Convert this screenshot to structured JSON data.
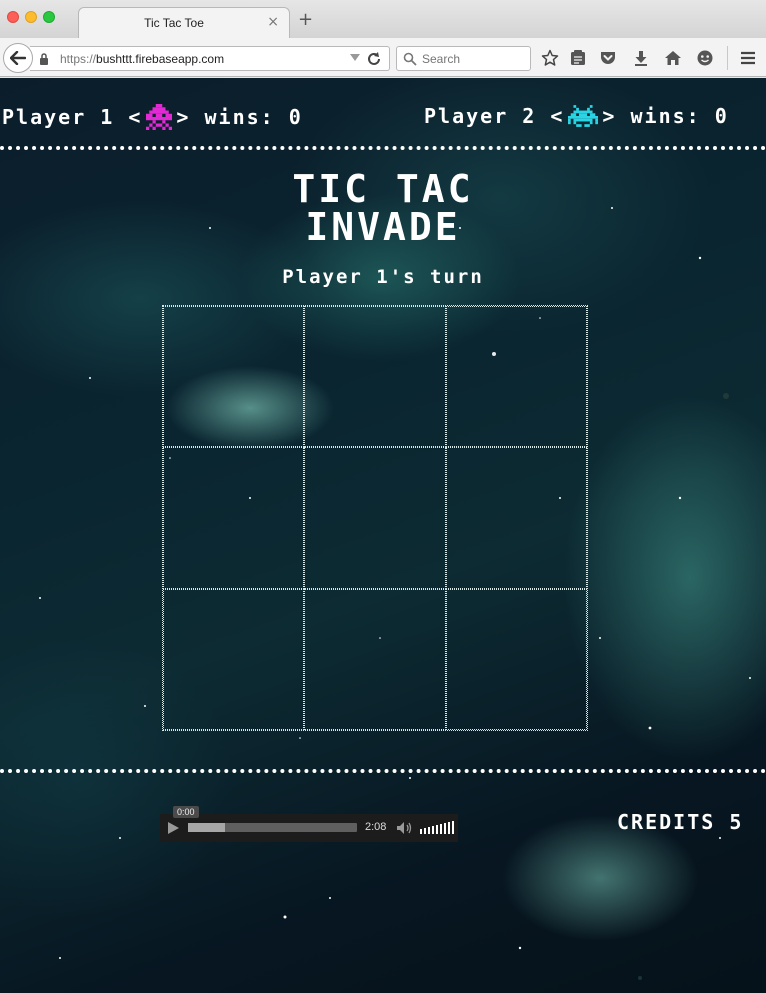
{
  "browser": {
    "tab_title": "Tic Tac Toe",
    "tab_close": "×",
    "new_tab": "+",
    "url_prefix": "https://",
    "url_host": "bushttt.firebaseapp.com",
    "search_placeholder": "Search",
    "toolbar_icons": [
      "star-icon",
      "reading-list-icon",
      "pocket-icon",
      "download-icon",
      "home-icon",
      "emoji-icon",
      "menu-icon"
    ]
  },
  "header": {
    "player1_label": "Player 1 <",
    "player1_suffix": "> wins: 0",
    "player1_icon": "squid-invader-icon",
    "player1_color": "#e22ad4",
    "player2_label": "Player 2 <",
    "player2_suffix": "> wins: 0",
    "player2_icon": "crab-invader-icon",
    "player2_color": "#2ad4e2"
  },
  "game": {
    "title_line1": "TIC TAC",
    "title_line2": "INVADE",
    "turn_text": "Player 1's turn",
    "board": [
      "",
      "",
      "",
      "",
      "",
      "",
      "",
      "",
      ""
    ]
  },
  "audio": {
    "current_time": "0:00",
    "duration": "2:08",
    "progress_fraction": 0.22
  },
  "credits_text": "CREDITS 5"
}
